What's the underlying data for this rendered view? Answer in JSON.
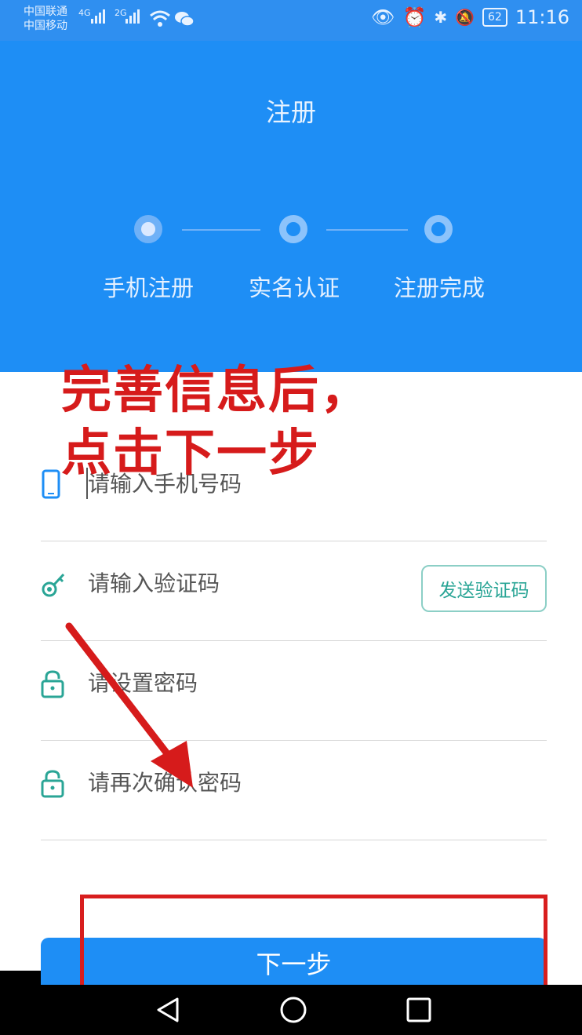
{
  "status_bar": {
    "carrier_1": "中国联通",
    "carrier_2": "中国移动",
    "net_1": "4G",
    "net_2": "2G",
    "battery": "62",
    "time": "11:16"
  },
  "header": {
    "title": "注册",
    "steps": [
      {
        "label": "手机注册",
        "state": "active"
      },
      {
        "label": "实名认证",
        "state": "pending"
      },
      {
        "label": "注册完成",
        "state": "pending"
      }
    ]
  },
  "form": {
    "phone_placeholder": "请输入手机号码",
    "code_placeholder": "请输入验证码",
    "send_code_label": "发送验证码",
    "password_placeholder": "请设置密码",
    "confirm_placeholder": "请再次确认密码"
  },
  "next_button_label": "下一步",
  "annotation": {
    "line1": "完善信息后，",
    "line2": "点击下一步"
  },
  "colors": {
    "primary": "#1e8ef5",
    "teal": "#2aa596",
    "annotation_red": "#d61b1b"
  },
  "icons": [
    "phone-icon",
    "key-icon",
    "lock-icon",
    "back-icon",
    "home-icon",
    "recent-apps-icon"
  ]
}
